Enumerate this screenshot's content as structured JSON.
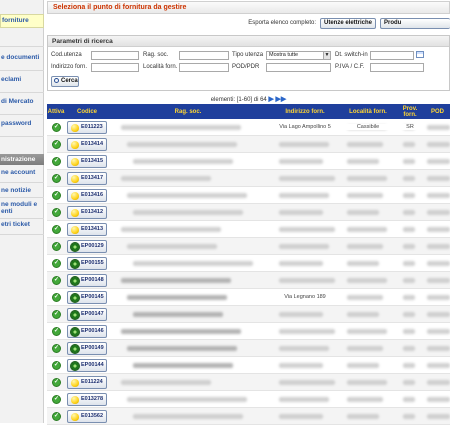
{
  "sidebar": {
    "items": [
      {
        "label": "forniture",
        "active": true
      },
      {
        "label": "e documenti",
        "active": false
      },
      {
        "label": "eclami",
        "active": false
      },
      {
        "label": "di Mercato",
        "active": false
      },
      {
        "label": "password",
        "active": false
      }
    ],
    "admin_header": "nistrazione",
    "admin_items": [
      {
        "label": "ne account"
      },
      {
        "label": "ne notizie"
      },
      {
        "label": "ne moduli e"
      },
      {
        "label": "enti"
      },
      {
        "label": "etri ticket"
      }
    ]
  },
  "page_title": "Seleziona il punto di fornitura da gestire",
  "export": {
    "label": "Esporta elenco completo:",
    "button1": "Utenze elettriche",
    "button2": "Produ"
  },
  "search": {
    "title": "Parametri di ricerca",
    "fields": {
      "cod_utenza": "Cod.utenza",
      "rag_soc": "Rag. soc.",
      "tipo_utenza": "Tipo utenza",
      "tipo_utenza_value": "Mostra tutte",
      "dt_switch_in": "Dt. switch-in",
      "indirizzo_forn": "Indirizzo forn.",
      "localita_forn": "Località forn.",
      "pod_pdr": "POD/PDR",
      "piva_cf": "P.IVA / C.F."
    },
    "button": "Cerca"
  },
  "pager": {
    "text": "elementi: [1-60] di 64",
    "next_icon": "arrow-right-icon",
    "last_icon": "double-arrow-right-icon"
  },
  "table": {
    "headers": {
      "attiva": "Attiva",
      "codice": "Codice",
      "rag_soc": "Rag. soc.",
      "indirizzo": "Indirizzo forn.",
      "localita": "Località forn.",
      "prov": "Prov. forn.",
      "pod": "POD"
    },
    "rows": [
      {
        "code": "E011223",
        "icon": "bulb-icon",
        "addr": "Via Lago Ampollino 5",
        "loc": "Cassibile",
        "prov": "SR"
      },
      {
        "code": "E013414",
        "icon": "bulb-icon",
        "addr": "",
        "loc": "",
        "prov": ""
      },
      {
        "code": "E013415",
        "icon": "bulb-icon",
        "addr": "",
        "loc": "",
        "prov": ""
      },
      {
        "code": "E013417",
        "icon": "bulb-icon",
        "addr": "",
        "loc": "",
        "prov": ""
      },
      {
        "code": "E013416",
        "icon": "bulb-icon",
        "addr": "",
        "loc": "",
        "prov": ""
      },
      {
        "code": "E013412",
        "icon": "bulb-icon",
        "addr": "",
        "loc": "",
        "prov": ""
      },
      {
        "code": "E013413",
        "icon": "bulb-icon",
        "addr": "",
        "loc": "",
        "prov": ""
      },
      {
        "code": "EP00129",
        "icon": "gear-icon",
        "addr": "",
        "loc": "",
        "prov": ""
      },
      {
        "code": "EP00155",
        "icon": "gear-icon",
        "addr": "",
        "loc": "",
        "prov": ""
      },
      {
        "code": "EP00148",
        "icon": "gear-icon",
        "addr": "",
        "loc": "",
        "prov": ""
      },
      {
        "code": "EP00145",
        "icon": "gear-icon",
        "addr": "Via Legnano 189",
        "loc": "",
        "prov": ""
      },
      {
        "code": "EP00147",
        "icon": "gear-icon",
        "addr": "",
        "loc": "",
        "prov": ""
      },
      {
        "code": "EP00146",
        "icon": "gear-icon",
        "addr": "",
        "loc": "",
        "prov": ""
      },
      {
        "code": "EP00149",
        "icon": "gear-icon",
        "addr": "",
        "loc": "",
        "prov": ""
      },
      {
        "code": "EP00144",
        "icon": "gear-icon",
        "addr": "",
        "loc": "",
        "prov": ""
      },
      {
        "code": "E011224",
        "icon": "bulb-icon",
        "addr": "",
        "loc": "",
        "prov": ""
      },
      {
        "code": "E013278",
        "icon": "bulb-icon",
        "addr": "",
        "loc": "",
        "prov": ""
      },
      {
        "code": "E013562",
        "icon": "bulb-icon",
        "addr": "",
        "loc": "",
        "prov": ""
      }
    ]
  },
  "colors": {
    "title_red": "#cc3300",
    "header_blue": "#1f3f9c",
    "header_text": "#ffd633",
    "active_green": "#43a83a"
  }
}
